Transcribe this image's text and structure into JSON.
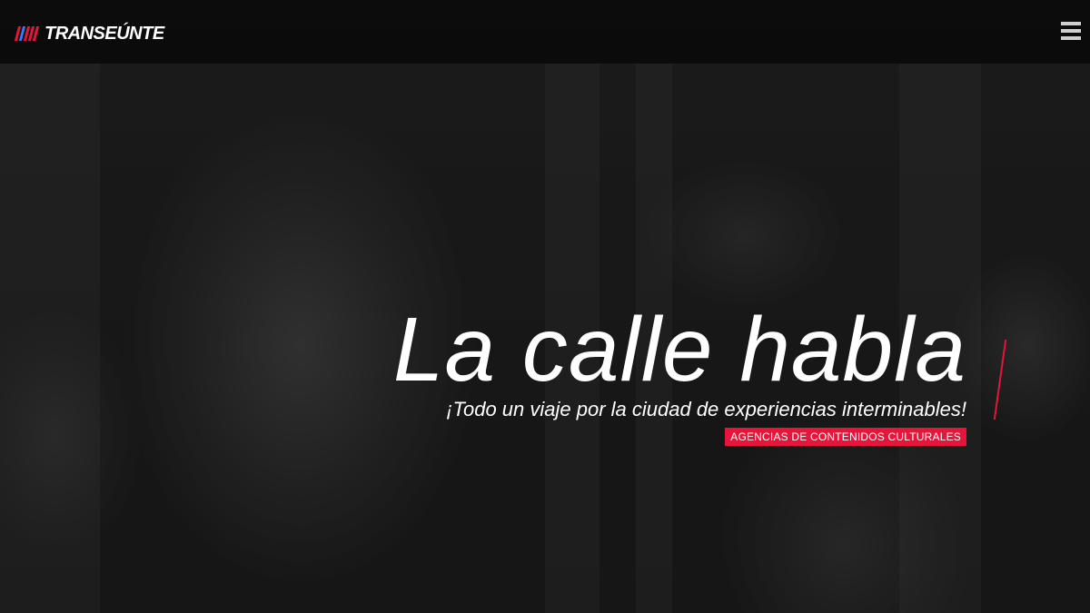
{
  "header": {
    "logo_text": "TRANSEÚNTE",
    "logo_colors": [
      "#e8153a",
      "#2a7fff",
      "#e8153a",
      "#e8153a",
      "#e8153a"
    ],
    "menu_icon": "hamburger-menu-icon"
  },
  "hero": {
    "title": "La calle habla",
    "subtitle": "¡Todo un viaje por la ciudad de experiencias interminables!",
    "badge": "AGENCIAS DE CONTENIDOS CULTURALES",
    "accent_color": "#e8153a"
  }
}
